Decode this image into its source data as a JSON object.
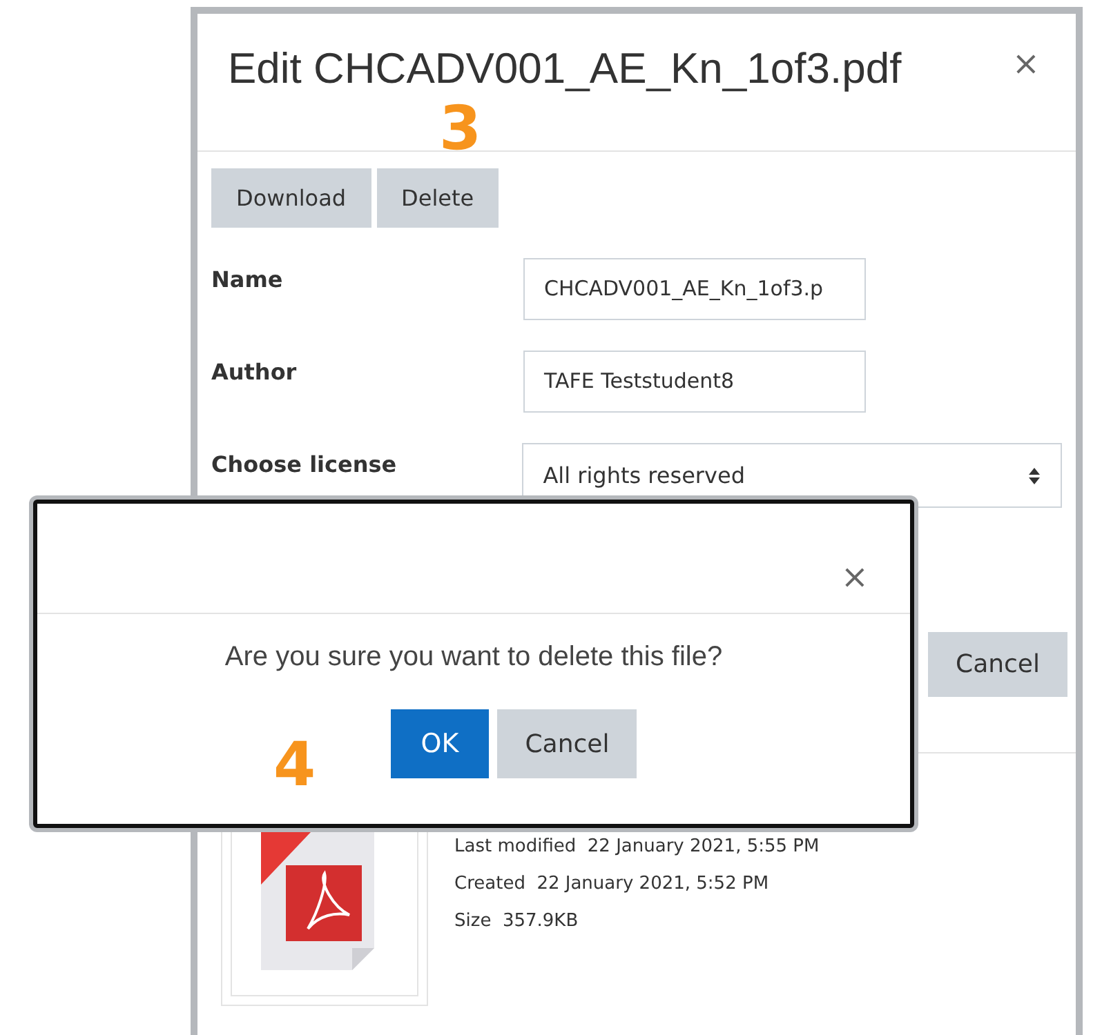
{
  "edit_dialog": {
    "title": "Edit CHCADV001_AE_Kn_1of3.pdf",
    "close": "×",
    "buttons": [
      "Download",
      "Delete"
    ],
    "fields": [
      {
        "label": "Name",
        "kind": "input",
        "value": "CHCADV001_AE_Kn_1of3.p"
      },
      {
        "label": "Author",
        "kind": "input",
        "value": "TAFE Teststudent8"
      },
      {
        "label": "Choose license",
        "kind": "select",
        "value": "All rights reserved"
      }
    ],
    "footer_buttons": [
      "Cancel"
    ],
    "file_info": [
      {
        "label": "Last modified",
        "value": "22 January 2021, 5:55 PM"
      },
      {
        "label": "Created",
        "value": "22 January 2021, 5:52 PM"
      },
      {
        "label": "Size",
        "value": "357.9KB"
      }
    ]
  },
  "confirm_dialog": {
    "close": "×",
    "message": "Are you sure you want to delete this file?",
    "buttons": [
      {
        "label": "OK",
        "primary": true
      },
      {
        "label": "Cancel",
        "primary": false
      }
    ]
  },
  "step_markers": [
    "3",
    "4"
  ]
}
